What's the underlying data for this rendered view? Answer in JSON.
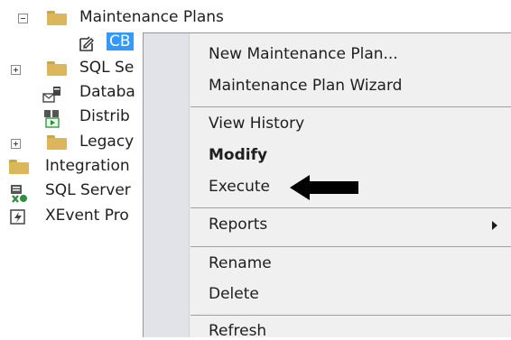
{
  "tree": {
    "items": [
      {
        "label": "Maintenance Plans",
        "icon": "folder-icon",
        "expander": "collapse"
      },
      {
        "label": "CB",
        "icon": "maintenance-plan-icon",
        "selected": true
      },
      {
        "label": "SQL Se",
        "icon": "folder-icon",
        "expander": "expand"
      },
      {
        "label": "Databa",
        "icon": "database-mail-icon"
      },
      {
        "label": "Distrib",
        "icon": "distributed-transaction-coordinator-icon"
      },
      {
        "label": "Legacy",
        "icon": "folder-icon",
        "expander": "expand"
      },
      {
        "label": "Integration",
        "icon": "folder-icon"
      },
      {
        "label": "SQL Server",
        "icon": "sql-server-agent-icon"
      },
      {
        "label": "XEvent Pro",
        "icon": "xevent-profiler-icon"
      }
    ]
  },
  "context_menu": {
    "items": [
      {
        "label": "New Maintenance Plan..."
      },
      {
        "label": "Maintenance Plan Wizard"
      },
      {
        "label": "View History"
      },
      {
        "label": "Modify",
        "bold": true
      },
      {
        "label": "Execute",
        "annotation": "black-arrow"
      },
      {
        "label": "Reports",
        "submenu": true
      },
      {
        "label": "Rename"
      },
      {
        "label": "Delete"
      },
      {
        "label": "Refresh"
      }
    ]
  },
  "colors": {
    "selection": "#3399ff",
    "menu_background": "#f0f0f0",
    "menu_gutter": "#e1e3e8",
    "folder": "#dcb65a"
  }
}
